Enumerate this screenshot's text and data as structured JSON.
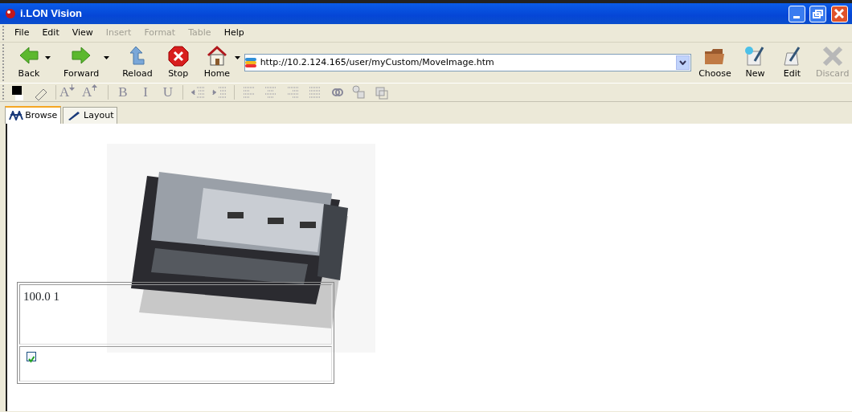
{
  "window": {
    "title": "i.LON Vision"
  },
  "menu": [
    {
      "label": "File",
      "disabled": false
    },
    {
      "label": "Edit",
      "disabled": false
    },
    {
      "label": "View",
      "disabled": false
    },
    {
      "label": "Insert",
      "disabled": true
    },
    {
      "label": "Format",
      "disabled": true
    },
    {
      "label": "Table",
      "disabled": true
    },
    {
      "label": "Help",
      "disabled": false
    }
  ],
  "nav_buttons": [
    {
      "kind": "back",
      "label": "Back",
      "dropdown": true
    },
    {
      "kind": "forward",
      "label": "Forward",
      "dropdown": true
    },
    {
      "kind": "reload",
      "label": "Reload",
      "dropdown": false
    },
    {
      "kind": "stop",
      "label": "Stop",
      "dropdown": false
    },
    {
      "kind": "home",
      "label": "Home",
      "dropdown": true
    }
  ],
  "address": {
    "value": "http://10.2.124.165/user/myCustom/MoveImage.htm"
  },
  "action_buttons": [
    {
      "kind": "folder",
      "label": "Choose",
      "disabled": false
    },
    {
      "kind": "new",
      "label": "New",
      "disabled": false
    },
    {
      "kind": "edit",
      "label": "Edit",
      "disabled": false
    },
    {
      "kind": "discard",
      "label": "Discard",
      "disabled": true
    }
  ],
  "format_tools": [
    {
      "kind": "color"
    },
    {
      "kind": "eraser"
    },
    {
      "kind": "sep"
    },
    {
      "kind": "shrink",
      "label": "A"
    },
    {
      "kind": "grow",
      "label": "A"
    },
    {
      "kind": "sep"
    },
    {
      "kind": "glyph",
      "label": "B"
    },
    {
      "kind": "glyph",
      "label": "I"
    },
    {
      "kind": "glyph",
      "label": "U"
    },
    {
      "kind": "sep"
    },
    {
      "kind": "outdent"
    },
    {
      "kind": "indent"
    },
    {
      "kind": "sep"
    },
    {
      "kind": "align-left"
    },
    {
      "kind": "align-center"
    },
    {
      "kind": "align-right"
    },
    {
      "kind": "justify"
    },
    {
      "kind": "link"
    },
    {
      "kind": "shapes"
    },
    {
      "kind": "layers"
    }
  ],
  "tabs": [
    {
      "kind": "browse",
      "label": "Browse",
      "selected": true
    },
    {
      "kind": "layout",
      "label": "Layout",
      "selected": false
    }
  ],
  "content": {
    "value_text": "100.0 1",
    "checkbox": {
      "checked": true
    }
  }
}
